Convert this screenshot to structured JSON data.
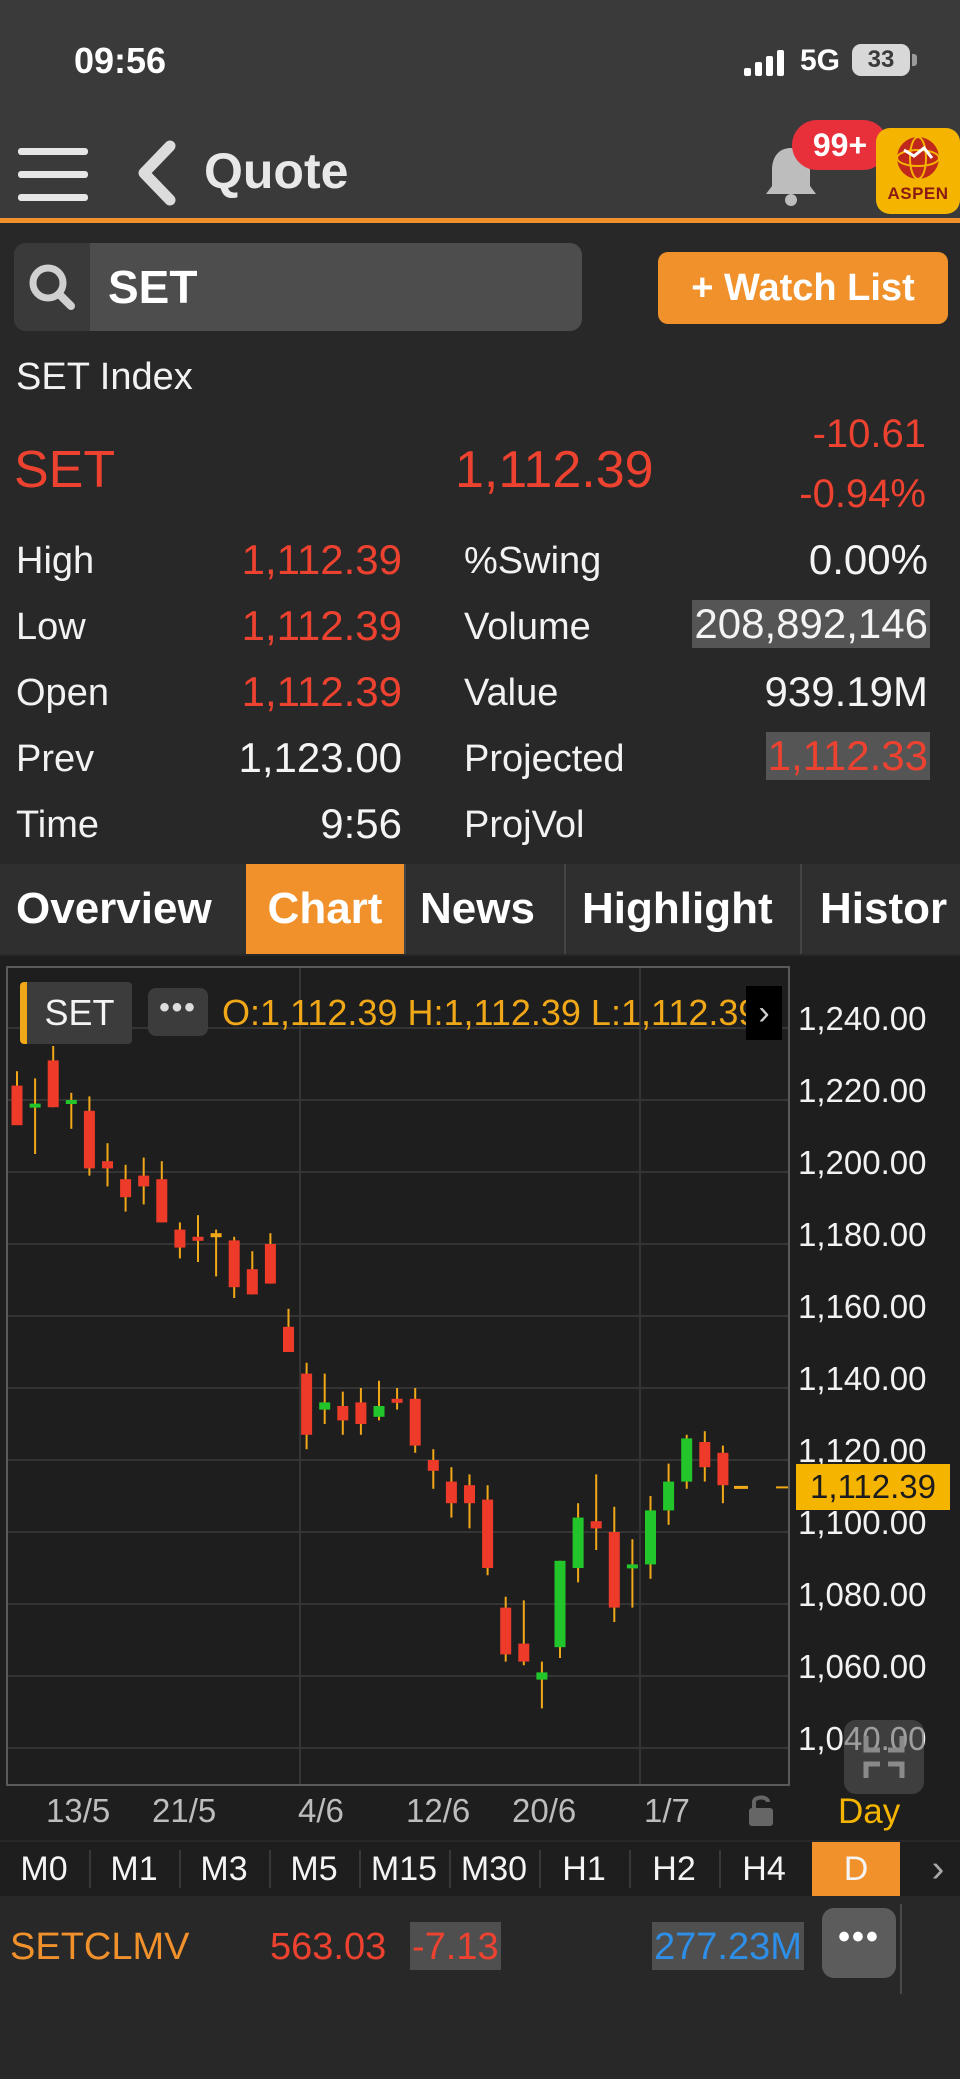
{
  "status_bar": {
    "time": "09:56",
    "network": "5G",
    "battery": "33"
  },
  "nav": {
    "title": "Quote",
    "notification_count": "99+",
    "logo_text": "ASPEN"
  },
  "search": {
    "value": "SET"
  },
  "watch_list_button": "+ Watch List",
  "quote": {
    "index_name": "SET Index",
    "symbol": "SET",
    "last": "1,112.39",
    "change": "-10.61",
    "percent_change": "-0.94%",
    "stats": {
      "high_label": "High",
      "high": "1,112.39",
      "low_label": "Low",
      "low": "1,112.39",
      "open_label": "Open",
      "open": "1,112.39",
      "prev_label": "Prev",
      "prev": "1,123.00",
      "time_label": "Time",
      "time": "9:56",
      "swing_label": "%Swing",
      "swing": "0.00%",
      "volume_label": "Volume",
      "volume": "208,892,146",
      "value_label": "Value",
      "value": "939.19M",
      "projected_label": "Projected",
      "projected": "1,112.33",
      "projvol_label": "ProjVol"
    }
  },
  "tabs": [
    {
      "label": "Overview",
      "active": false
    },
    {
      "label": "Chart",
      "active": true
    },
    {
      "label": "News",
      "active": false
    },
    {
      "label": "Highlight",
      "active": false
    },
    {
      "label": "Histor",
      "active": false
    }
  ],
  "chart": {
    "symbol_button": "SET",
    "more_button": "•••",
    "ohlc_text": "O:1,112.39  H:1,112.39  L:1,112.39",
    "y_ticks": [
      "1,240.00",
      "1,220.00",
      "1,200.00",
      "1,180.00",
      "1,160.00",
      "1,140.00",
      "1,120.00",
      "1,100.00",
      "1,080.00",
      "1,060.00",
      "1,040.00"
    ],
    "x_ticks": [
      "13/5",
      "21/5",
      "4/6",
      "12/6",
      "20/6",
      "1/7"
    ],
    "current_price_tag": "1,112.39",
    "period_label": "Day",
    "colors": {
      "up": "#22c62a",
      "down": "#ee3a28",
      "doji": "#f0a818",
      "grid": "#343434"
    }
  },
  "chart_data": {
    "type": "candlestick",
    "ylim": [
      1030,
      1250
    ],
    "y_ticks": [
      1240,
      1220,
      1200,
      1180,
      1160,
      1140,
      1120,
      1100,
      1080,
      1060,
      1040
    ],
    "x_tick_labels": [
      "13/5",
      "21/5",
      "4/6",
      "12/6",
      "20/6",
      "1/7"
    ],
    "candles": [
      {
        "o": 1224,
        "h": 1228,
        "l": 1214,
        "c": 1213
      },
      {
        "o": 1218,
        "h": 1226,
        "l": 1205,
        "c": 1219
      },
      {
        "o": 1231,
        "h": 1235,
        "l": 1218,
        "c": 1218
      },
      {
        "o": 1219,
        "h": 1222,
        "l": 1212,
        "c": 1220
      },
      {
        "o": 1217,
        "h": 1221,
        "l": 1199,
        "c": 1201
      },
      {
        "o": 1203,
        "h": 1208,
        "l": 1196,
        "c": 1201
      },
      {
        "o": 1198,
        "h": 1202,
        "l": 1189,
        "c": 1193
      },
      {
        "o": 1199,
        "h": 1204,
        "l": 1191,
        "c": 1196
      },
      {
        "o": 1198,
        "h": 1203,
        "l": 1186,
        "c": 1186
      },
      {
        "o": 1184,
        "h": 1186,
        "l": 1176,
        "c": 1179
      },
      {
        "o": 1182,
        "h": 1188,
        "l": 1175,
        "c": 1181
      },
      {
        "o": 1183,
        "h": 1184,
        "l": 1171,
        "c": 1183
      },
      {
        "o": 1181,
        "h": 1182,
        "l": 1165,
        "c": 1168
      },
      {
        "o": 1173,
        "h": 1178,
        "l": 1166,
        "c": 1166
      },
      {
        "o": 1180,
        "h": 1183,
        "l": 1169,
        "c": 1169
      },
      {
        "o": 1157,
        "h": 1162,
        "l": 1150,
        "c": 1150
      },
      {
        "o": 1144,
        "h": 1147,
        "l": 1123,
        "c": 1127
      },
      {
        "o": 1134,
        "h": 1144,
        "l": 1130,
        "c": 1136
      },
      {
        "o": 1135,
        "h": 1139,
        "l": 1127,
        "c": 1131
      },
      {
        "o": 1136,
        "h": 1140,
        "l": 1127,
        "c": 1130
      },
      {
        "o": 1132,
        "h": 1142,
        "l": 1131,
        "c": 1135
      },
      {
        "o": 1137,
        "h": 1140,
        "l": 1134,
        "c": 1136
      },
      {
        "o": 1137,
        "h": 1140,
        "l": 1122,
        "c": 1124
      },
      {
        "o": 1120,
        "h": 1123,
        "l": 1112,
        "c": 1117
      },
      {
        "o": 1114,
        "h": 1118,
        "l": 1104,
        "c": 1108
      },
      {
        "o": 1113,
        "h": 1116,
        "l": 1101,
        "c": 1108
      },
      {
        "o": 1109,
        "h": 1113,
        "l": 1088,
        "c": 1090
      },
      {
        "o": 1079,
        "h": 1082,
        "l": 1064,
        "c": 1066
      },
      {
        "o": 1069,
        "h": 1081,
        "l": 1063,
        "c": 1064
      },
      {
        "o": 1059,
        "h": 1064,
        "l": 1051,
        "c": 1061
      },
      {
        "o": 1068,
        "h": 1092,
        "l": 1065,
        "c": 1092
      },
      {
        "o": 1090,
        "h": 1108,
        "l": 1086,
        "c": 1104
      },
      {
        "o": 1103,
        "h": 1116,
        "l": 1095,
        "c": 1101
      },
      {
        "o": 1100,
        "h": 1107,
        "l": 1075,
        "c": 1079
      },
      {
        "o": 1090,
        "h": 1098,
        "l": 1079,
        "c": 1091
      },
      {
        "o": 1091,
        "h": 1110,
        "l": 1087,
        "c": 1106
      },
      {
        "o": 1106,
        "h": 1119,
        "l": 1102,
        "c": 1114
      },
      {
        "o": 1114,
        "h": 1127,
        "l": 1112,
        "c": 1126
      },
      {
        "o": 1125,
        "h": 1128,
        "l": 1114,
        "c": 1118
      },
      {
        "o": 1122,
        "h": 1124,
        "l": 1108,
        "c": 1113
      },
      {
        "o": 1112.39,
        "h": 1112.39,
        "l": 1112.39,
        "c": 1112.39
      }
    ]
  },
  "timeframes": [
    {
      "label": "M0",
      "active": false
    },
    {
      "label": "M1",
      "active": false
    },
    {
      "label": "M3",
      "active": false
    },
    {
      "label": "M5",
      "active": false
    },
    {
      "label": "M15",
      "active": false
    },
    {
      "label": "M30",
      "active": false
    },
    {
      "label": "H1",
      "active": false
    },
    {
      "label": "H2",
      "active": false
    },
    {
      "label": "H4",
      "active": false
    },
    {
      "label": "D",
      "active": true
    }
  ],
  "ticker": {
    "name": "SETCLMV",
    "price": "563.03",
    "change": "-7.13",
    "volume": "277.23M",
    "more": "•••"
  }
}
